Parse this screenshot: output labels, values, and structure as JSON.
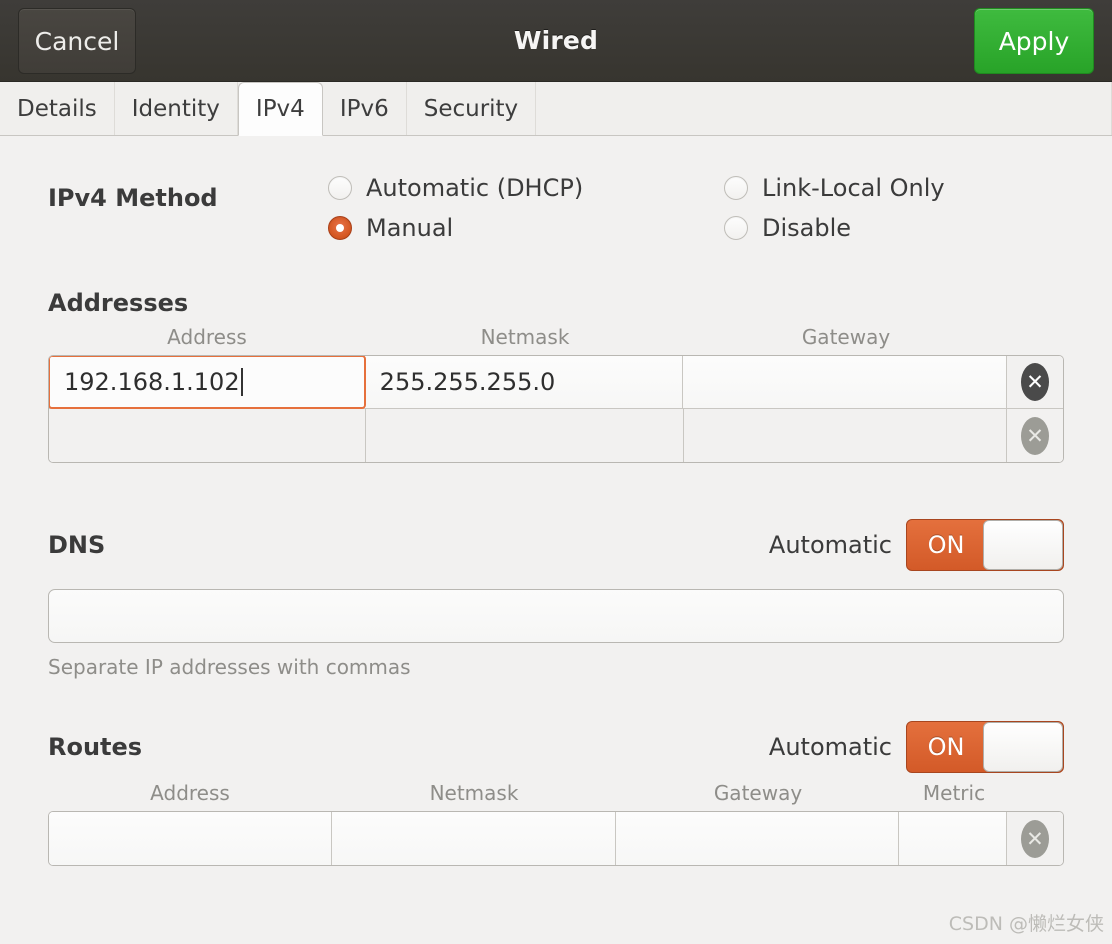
{
  "titlebar": {
    "cancel_label": "Cancel",
    "title": "Wired",
    "apply_label": "Apply"
  },
  "tabs": [
    {
      "label": "Details",
      "selected": false
    },
    {
      "label": "Identity",
      "selected": false
    },
    {
      "label": "IPv4",
      "selected": true
    },
    {
      "label": "IPv6",
      "selected": false
    },
    {
      "label": "Security",
      "selected": false
    }
  ],
  "ipv4_method": {
    "label": "IPv4 Method",
    "options": [
      {
        "label": "Automatic (DHCP)",
        "selected": false
      },
      {
        "label": "Link-Local Only",
        "selected": false
      },
      {
        "label": "Manual",
        "selected": true
      },
      {
        "label": "Disable",
        "selected": false
      }
    ]
  },
  "addresses": {
    "label": "Addresses",
    "columns": [
      "Address",
      "Netmask",
      "Gateway"
    ],
    "rows": [
      {
        "address": "192.168.1.102",
        "netmask": "255.255.255.0",
        "gateway": "",
        "focused": true,
        "delete_enabled": true
      },
      {
        "address": "",
        "netmask": "",
        "gateway": "",
        "focused": false,
        "delete_enabled": false
      }
    ],
    "delete_icon": "close-circle-icon"
  },
  "dns": {
    "label": "DNS",
    "automatic_label": "Automatic",
    "toggle_state": "ON",
    "value": "",
    "hint": "Separate IP addresses with commas"
  },
  "routes": {
    "label": "Routes",
    "automatic_label": "Automatic",
    "toggle_state": "ON",
    "columns": [
      "Address",
      "Netmask",
      "Gateway",
      "Metric"
    ],
    "rows": [
      {
        "address": "",
        "netmask": "",
        "gateway": "",
        "metric": "",
        "delete_enabled": false
      }
    ]
  },
  "watermark": "CSDN @懒烂女侠",
  "colors": {
    "accent_orange": "#d35a28",
    "apply_green": "#2eb82e",
    "titlebar_dark": "#3b3934",
    "background": "#f2f1f0"
  }
}
